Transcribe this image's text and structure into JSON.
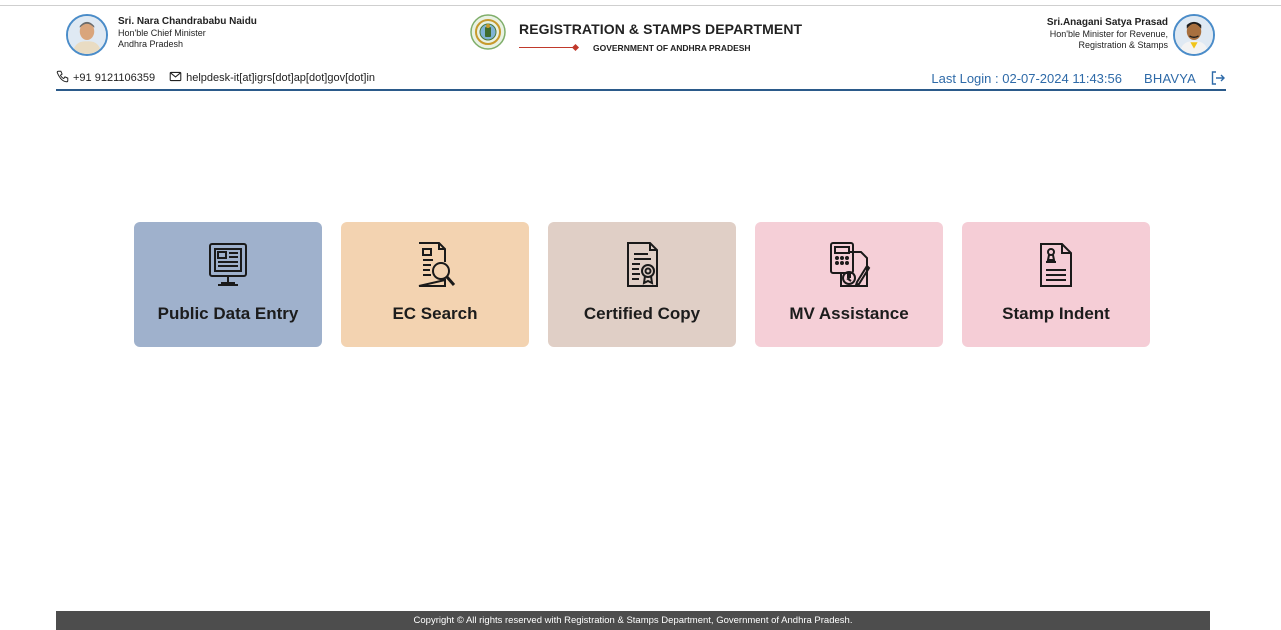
{
  "header": {
    "cm": {
      "name": "Sri. Nara Chandrababu Naidu",
      "designation": "Hon'ble Chief Minister",
      "state": "Andhra Pradesh"
    },
    "department": {
      "title": "REGISTRATION & STAMPS DEPARTMENT",
      "subtitle": "GOVERNMENT OF ANDHRA PRADESH"
    },
    "minister": {
      "name": "Sri.Anagani Satya Prasad",
      "designation_line1": "Hon'ble Minister for Revenue,",
      "designation_line2": "Registration & Stamps"
    },
    "contact": {
      "phone": "+91 9121106359",
      "email": "helpdesk-it[at]igrs[dot]ap[dot]gov[dot]in"
    },
    "session": {
      "last_login": "Last Login : 02-07-2024 11:43:56",
      "user": "BHAVYA"
    }
  },
  "tiles": [
    {
      "label": "Public Data Entry",
      "icon": "monitor-form-icon",
      "color": "#9fb1cc"
    },
    {
      "label": "EC Search",
      "icon": "document-search-icon",
      "color": "#f3d3b1"
    },
    {
      "label": "Certified Copy",
      "icon": "certificate-icon",
      "color": "#e0cfc6"
    },
    {
      "label": "MV Assistance",
      "icon": "calculator-rupee-icon",
      "color": "#f5cfd7"
    },
    {
      "label": "Stamp Indent",
      "icon": "stamp-document-icon",
      "color": "#f5cdd6"
    }
  ],
  "footer": {
    "copyright": "Copyright © All rights reserved with Registration & Stamps Department, Government of Andhra Pradesh."
  },
  "colors": {
    "accent": "#2e6aa8",
    "header_rule": "#2b5a8a",
    "footer_bg": "#4d4d4d"
  }
}
